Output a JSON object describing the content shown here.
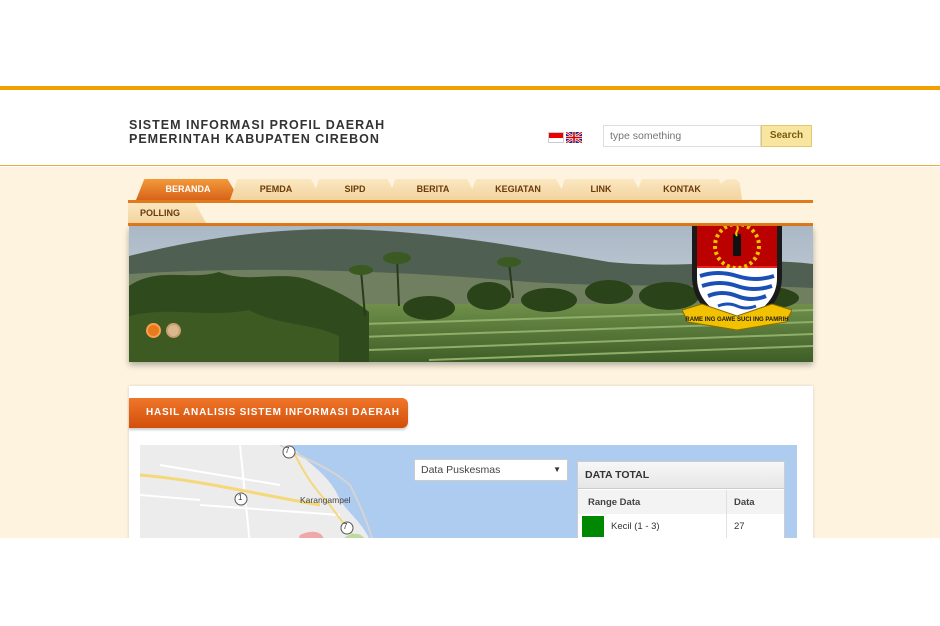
{
  "header": {
    "title_line1": "SISTEM INFORMASI PROFIL DAERAH",
    "title_line2": "PEMERINTAH KABUPATEN CIREBON",
    "search_placeholder": "type something",
    "search_button": "Search"
  },
  "nav": {
    "tabs": [
      {
        "label": "BERANDA",
        "active": true
      },
      {
        "label": "PEMDA",
        "active": false
      },
      {
        "label": "SIPD",
        "active": false
      },
      {
        "label": "BERITA",
        "active": false
      },
      {
        "label": "KEGIATAN",
        "active": false
      },
      {
        "label": "LINK",
        "active": false
      },
      {
        "label": "KONTAK",
        "active": false
      }
    ],
    "second_row": "POLLING"
  },
  "banner": {
    "emblem_motto": "RAME ING GAWE SUCI ING PAMRIH"
  },
  "panel": {
    "heading": "HASIL ANALISIS SISTEM INFORMASI DAERAH",
    "map": {
      "select_value": "Data Puskesmas",
      "place_label": "Karangampel",
      "road_markers": [
        "7",
        "1",
        "7"
      ]
    },
    "data_total": {
      "title": "DATA TOTAL",
      "col_range": "Range Data",
      "col_data": "Data",
      "rows": [
        {
          "label": "Kecil (1 - 3)",
          "value": "27",
          "color": "#008800"
        }
      ]
    }
  },
  "colors": {
    "accent": "#f0a000",
    "tab_active": "#e07a1c",
    "panel_heading": "#d85a10"
  }
}
